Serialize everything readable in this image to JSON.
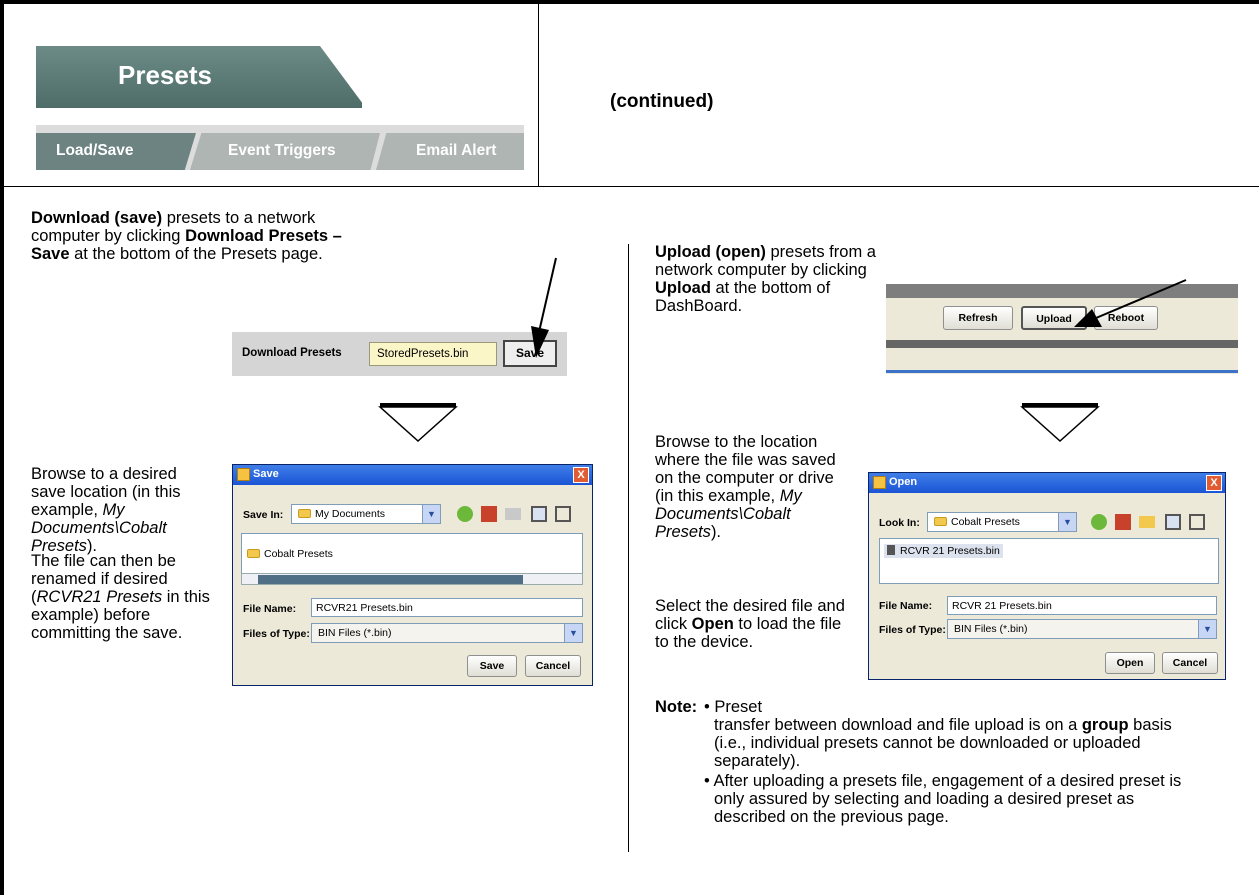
{
  "header": {
    "presets_title": "Presets",
    "tabs": [
      "Load/Save",
      "Event Triggers",
      "Email Alert"
    ],
    "continued": "(continued)"
  },
  "left": {
    "p1_b1": "Download (save)",
    "p1_t1": " presets to a network computer by clicking ",
    "p1_b2": "Download Presets – Save",
    "p1_t2": " at the bottom of the Presets page.",
    "download_bar": {
      "label": "Download Presets",
      "value": "StoredPresets.bin",
      "button": "Save"
    },
    "p2_t1": "Browse to a desired save location (in this example, ",
    "p2_i1": "My Documents\\Cobalt Presets",
    "p2_t2": ").",
    "p3_t1": "The file can then be renamed if desired (",
    "p3_i1": "RCVR21 Presets",
    "p3_t2": " in this example) before committing the save.",
    "save_dialog": {
      "title": "Save",
      "close": "X",
      "save_in_label": "Save In:",
      "save_in_value": "My Documents",
      "folder_item": "Cobalt Presets",
      "file_name_label": "File Name:",
      "file_name_value": "RCVR21 Presets.bin",
      "file_type_label": "Files of Type:",
      "file_type_value": "BIN Files (*.bin)",
      "save_button": "Save",
      "cancel_button": "Cancel"
    }
  },
  "right": {
    "p1_b1": "Upload (open)",
    "p1_t1": " presets from a network computer by clicking ",
    "p1_b2": "Upload",
    "p1_t2": " at the bottom of DashBoard.",
    "toolbar": {
      "refresh": "Refresh",
      "upload": "Upload",
      "reboot": "Reboot"
    },
    "p2": "Browse to the location where the file was saved on the computer or drive (in this example, ",
    "p2_i": "My Documents\\Cobalt Presets",
    "p2_t2": ").",
    "p3_t1": "Select the desired file and click ",
    "p3_b1": "Open",
    "p3_t2": " to load the file to the device.",
    "open_dialog": {
      "title": "Open",
      "close": "X",
      "look_in_label": "Look In:",
      "look_in_value": "Cobalt Presets",
      "file_item": "RCVR 21 Presets.bin",
      "file_name_label": "File Name:",
      "file_name_value": "RCVR 21 Presets.bin",
      "file_type_label": "Files of Type:",
      "file_type_value": "BIN Files (*.bin)",
      "open_button": "Open",
      "cancel_button": "Cancel"
    },
    "note_label": "Note:",
    "note1_a": "• Preset",
    "note1_b": "transfer between download and file upload is on a ",
    "note1_bold": "group",
    "note1_c": " basis (i.e., individual presets cannot be downloaded or uploaded separately).",
    "note2": "• After uploading a presets file, engagement of a desired preset is only assured by selecting and loading a desired preset as described on the previous page."
  }
}
